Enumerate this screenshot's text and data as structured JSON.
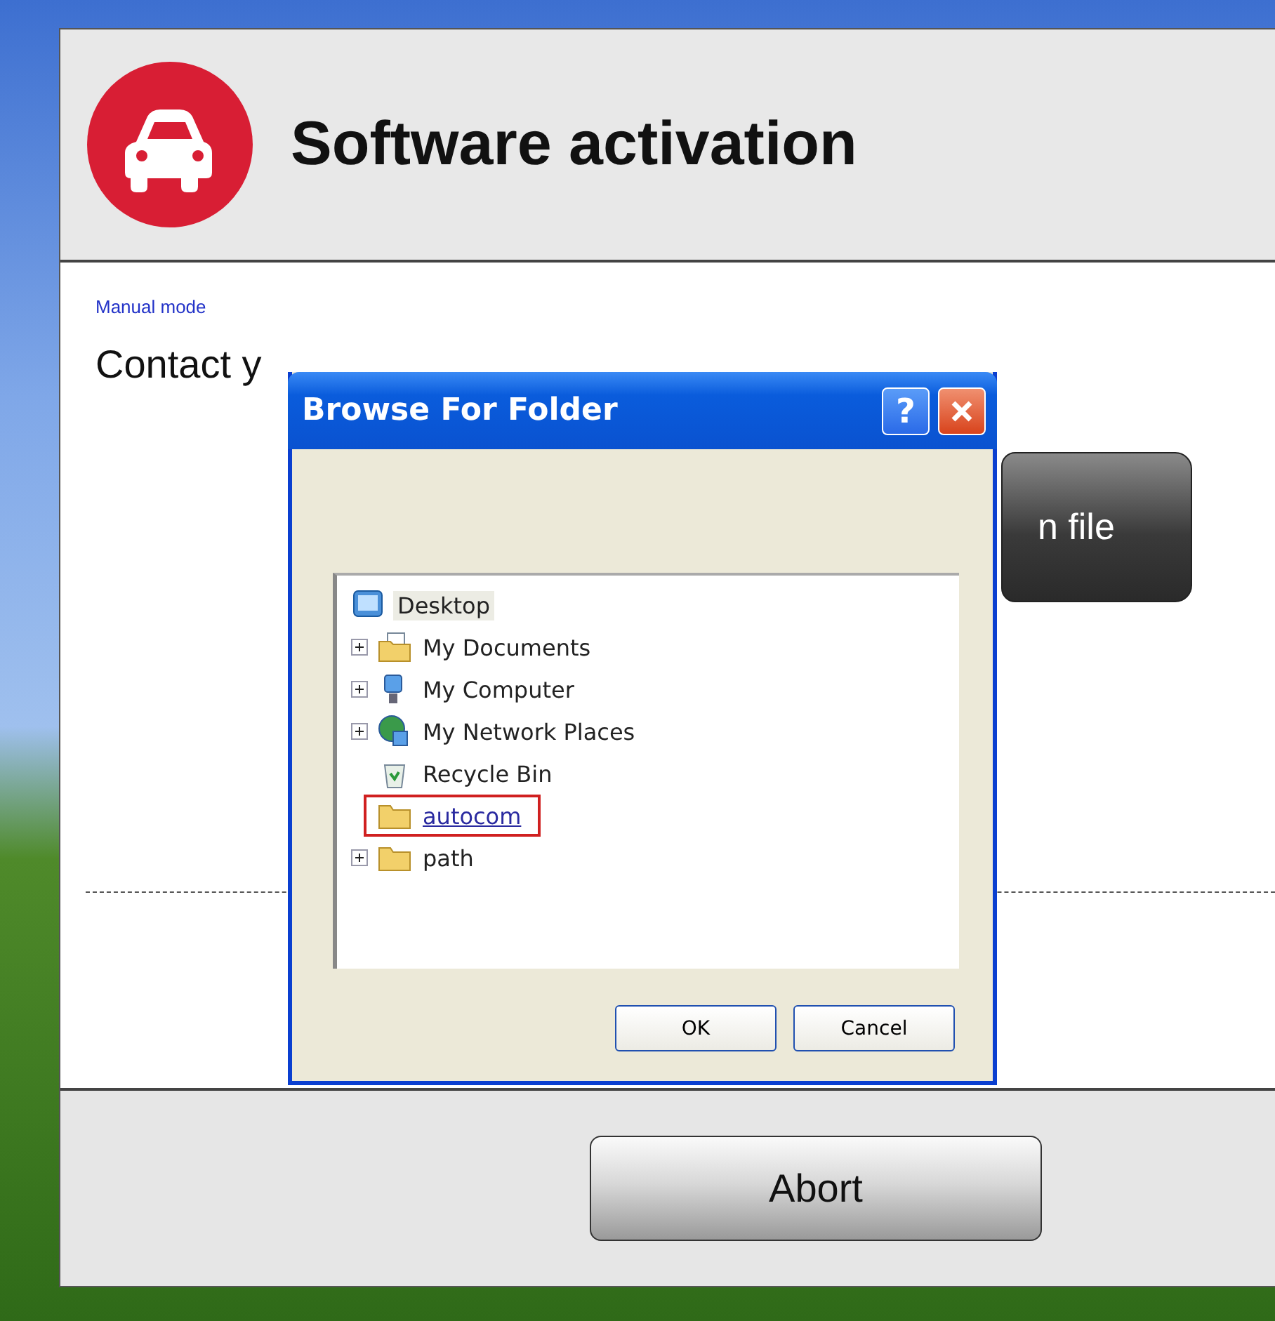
{
  "window": {
    "title": "Software activation"
  },
  "content": {
    "mode_link": "Manual mode",
    "instruction": "Contact y",
    "side_button": "n file"
  },
  "footer": {
    "abort_button": "Abort"
  },
  "dialog": {
    "title": "Browse For Folder",
    "help_button": "?",
    "tree": [
      {
        "label": "Desktop",
        "kind": "desktop",
        "selected": true,
        "expandable": false,
        "hovered": false,
        "highlighted": false,
        "children": [
          {
            "label": "My Documents",
            "kind": "documents",
            "selected": false,
            "expandable": true,
            "hovered": false,
            "highlighted": false
          },
          {
            "label": "My Computer",
            "kind": "computer",
            "selected": false,
            "expandable": true,
            "hovered": false,
            "highlighted": false
          },
          {
            "label": "My Network Places",
            "kind": "network",
            "selected": false,
            "expandable": true,
            "hovered": false,
            "highlighted": false
          },
          {
            "label": "Recycle Bin",
            "kind": "recycle",
            "selected": false,
            "expandable": false,
            "hovered": false,
            "highlighted": false
          },
          {
            "label": "autocom",
            "kind": "folder",
            "selected": false,
            "expandable": false,
            "hovered": true,
            "highlighted": true
          },
          {
            "label": "path",
            "kind": "folder",
            "selected": false,
            "expandable": true,
            "hovered": false,
            "highlighted": false
          }
        ]
      }
    ],
    "buttons": [
      "OK",
      "Cancel"
    ]
  }
}
